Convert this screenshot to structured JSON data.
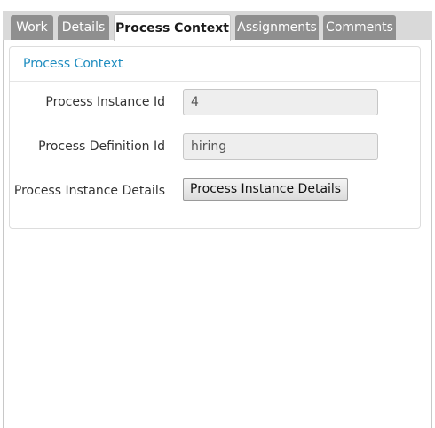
{
  "tabs": [
    {
      "label": "Work",
      "active": false
    },
    {
      "label": "Details",
      "active": false
    },
    {
      "label": "Process Context",
      "active": true
    },
    {
      "label": "Assignments",
      "active": false
    },
    {
      "label": "Comments",
      "active": false
    }
  ],
  "panel": {
    "heading": "Process Context",
    "fields": {
      "instance_id_label": "Process Instance Id",
      "instance_id_value": "4",
      "definition_id_label": "Process Definition Id",
      "definition_id_value": "hiring",
      "details_label": "Process Instance Details",
      "details_button": "Process Instance Details"
    }
  },
  "colors": {
    "tab_inactive": "#8f8f8f",
    "heading_accent": "#1f8dc0"
  }
}
